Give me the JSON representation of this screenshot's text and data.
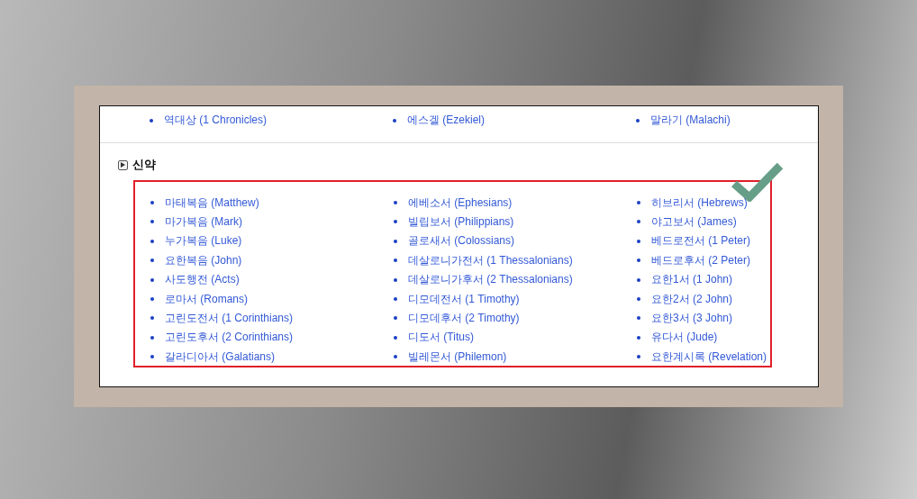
{
  "old_testament_last_row": [
    "역대상 (1 Chronicles)",
    "에스겔 (Ezekiel)",
    "말라기 (Malachi)"
  ],
  "new_testament": {
    "title": "신약",
    "columns": [
      [
        "마태복음 (Matthew)",
        "마가복음 (Mark)",
        "누가복음 (Luke)",
        "요한복음 (John)",
        "사도행전 (Acts)",
        "로마서 (Romans)",
        "고린도전서 (1 Corinthians)",
        "고린도후서 (2 Corinthians)",
        "갈라디아서 (Galatians)"
      ],
      [
        "에베소서 (Ephesians)",
        "빌립보서 (Philippians)",
        "골로새서 (Colossians)",
        "데살로니가전서 (1 Thessalonians)",
        "데살로니가후서 (2 Thessalonians)",
        "디모데전서 (1 Timothy)",
        "디모데후서 (2 Timothy)",
        "디도서 (Titus)",
        "빌레몬서 (Philemon)"
      ],
      [
        "히브리서 (Hebrews)",
        "야고보서 (James)",
        "베드로전서 (1 Peter)",
        "베드로후서 (2 Peter)",
        "요한1서 (1 John)",
        "요한2서 (2 John)",
        "요한3서 (3 John)",
        "유다서 (Jude)",
        "요한계시록 (Revelation)"
      ]
    ]
  }
}
